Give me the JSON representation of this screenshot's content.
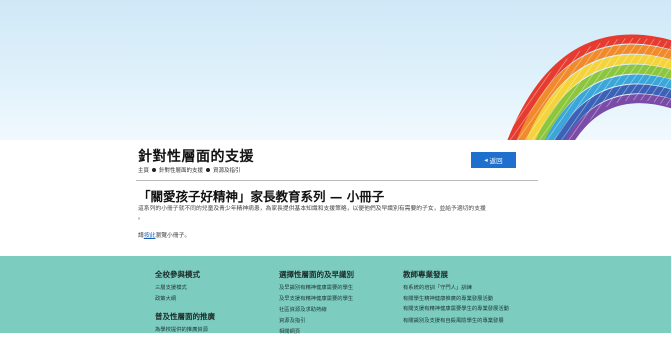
{
  "header": {
    "page_title": "針對性層面的支援",
    "breadcrumb": [
      "主頁",
      "針對性層面的支援",
      "資源及指引"
    ],
    "back_label": "返回"
  },
  "main": {
    "heading": "「關愛孩子好精神」家長教育系列 — 小冊子",
    "description_lines": [
      "這系列的小冊子就不同的兒童及青少年精神病患，為家長提供基本知識和支援策略，以便他們及早識別有需要的子女，並給予適切的支援",
      "。"
    ],
    "click_prefix": "請",
    "click_link": "按此",
    "click_suffix": "瀏覽小冊子。"
  },
  "footer": {
    "col1": {
      "heading": "全校參與模式",
      "links": [
        "三層支援模式",
        "政策大綱"
      ],
      "heading2": "普及性層面的推廣",
      "links2": [
        "為學校提供的推廣資源"
      ]
    },
    "col2": {
      "heading": "選擇性層面的及早識別",
      "links": [
        "及早識別有精神健康需要的學生",
        "及早支援有精神健康需要的學生",
        "社區資源及求助熱線",
        "資源及指引",
        "相關網頁"
      ]
    },
    "col3": {
      "heading": "教師專業發展",
      "links": [
        "有系統的培訓「守門人」訓練",
        "有關學生精神健康推廣的專業發展活動",
        "有關支援有精神健康需要學生的專業發展活動",
        "有關識別及支援有自殺風險學生的專業發展"
      ]
    }
  },
  "colors": {
    "banner_sky": "#dff1fb",
    "back_button": "#1f6fce",
    "footer_bg": "#7ccdbf",
    "link": "#1a5fb4"
  }
}
